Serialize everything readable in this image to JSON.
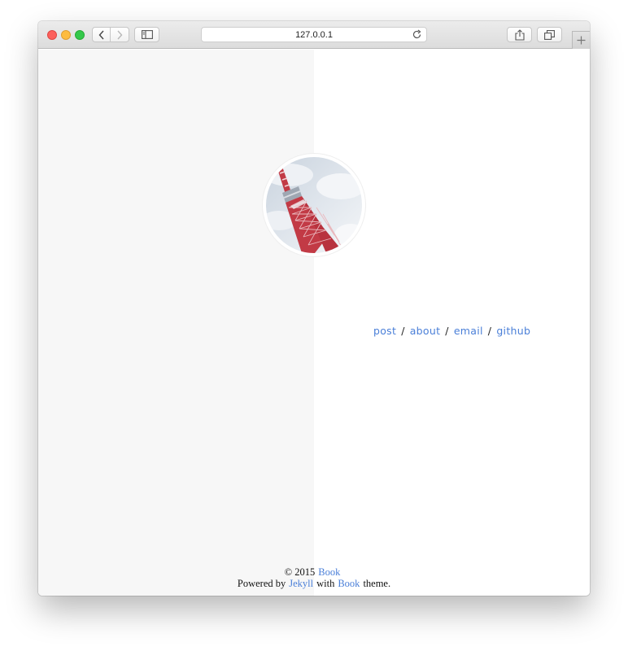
{
  "browser": {
    "address": "127.0.0.1",
    "accent_close": "#fc605c",
    "accent_minimize": "#fdbc40",
    "accent_maximize": "#34c84a",
    "icons": {
      "back": "chevron-left-icon",
      "forward": "chevron-right-icon",
      "sidebar": "sidebar-icon",
      "reload": "reload-icon",
      "share": "share-icon",
      "tabs": "tabs-icon",
      "new_tab": "plus-icon"
    }
  },
  "profile": {
    "avatar": "tokyo-tower-photo"
  },
  "nav": {
    "items": [
      {
        "label": "post"
      },
      {
        "label": "about"
      },
      {
        "label": "email"
      },
      {
        "label": "github"
      }
    ],
    "separator": "/",
    "link_color": "#4a7fd8"
  },
  "footer": {
    "copyright": "© 2015",
    "site_link": "Book",
    "powered_by": "Powered by",
    "jekyll_link": "Jekyll",
    "with": "with",
    "theme_link": "Book",
    "theme_suffix": "theme."
  }
}
